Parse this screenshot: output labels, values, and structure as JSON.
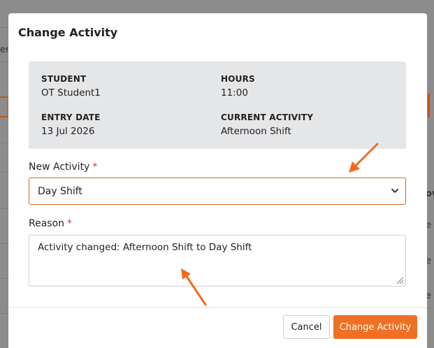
{
  "background": {
    "left_fragment": "er",
    "right_fragments": [
      "ov",
      "e",
      "e",
      "e"
    ]
  },
  "modal": {
    "title": "Change Activity",
    "info": {
      "student_label": "STUDENT",
      "student_value": "OT Student1",
      "hours_label": "HOURS",
      "hours_value": "11:00",
      "entry_date_label": "ENTRY DATE",
      "entry_date_value": "13 Jul 2026",
      "current_activity_label": "CURRENT ACTIVITY",
      "current_activity_value": "Afternoon Shift"
    },
    "new_activity": {
      "label": "New Activity",
      "required_marker": "*",
      "selected": "Day Shift"
    },
    "reason": {
      "label": "Reason",
      "required_marker": "*",
      "value": "Activity changed: Afternoon Shift to Day Shift"
    },
    "buttons": {
      "cancel": "Cancel",
      "submit": "Change Activity"
    }
  },
  "annotations": {
    "arrow_color": "#f26a21",
    "accent_color": "#ef7025"
  }
}
